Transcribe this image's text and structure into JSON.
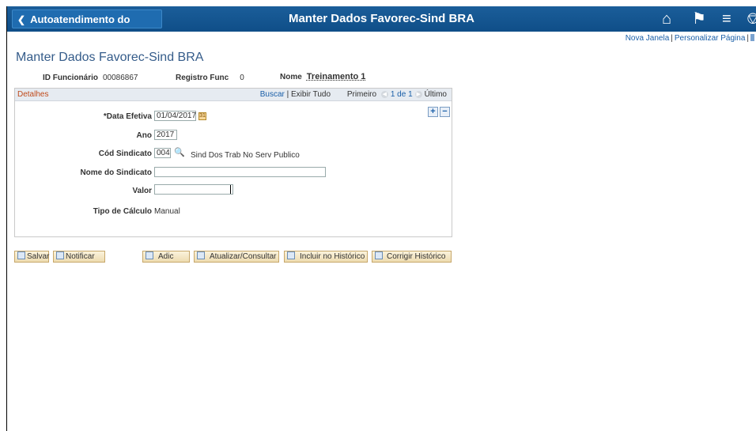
{
  "header": {
    "back_label": "Autoatendimento do Gerente",
    "title": "Manter Dados Favorec-Sind BRA"
  },
  "top_links": {
    "new_window": "Nova Janela",
    "personalize": "Personalizar Página"
  },
  "page_title": "Manter Dados Favorec-Sind BRA",
  "employee": {
    "id_label": "ID Funcionário",
    "id_value": "00086867",
    "reg_label": "Registro Func",
    "reg_value": "0",
    "name_label": "Nome",
    "name_value": "Treinamento 1"
  },
  "details": {
    "title": "Detalhes",
    "search_link": "Buscar",
    "show_all": "Exibir Tudo",
    "first": "Primeiro",
    "page_info": "1 de 1",
    "last": "Último",
    "fields": {
      "effective_date_label": "*Data Efetiva",
      "effective_date_value": "01/04/2017",
      "year_label": "Ano",
      "year_value": "2017",
      "union_code_label": "Cód Sindicato",
      "union_code_value": "004",
      "union_desc": "Sind Dos Trab No Serv Publico",
      "union_name_label": "Nome do Sindicato",
      "union_name_value": "",
      "value_label": "Valor",
      "value_value": "",
      "calc_type_label": "Tipo de Cálculo",
      "calc_type_value": "Manual"
    }
  },
  "toolbar": {
    "save": "Salvar",
    "notify": "Notificar",
    "add": "Adic",
    "update": "Atualizar/Consultar",
    "include_history": "Incluir no Histórico",
    "correct_history": "Corrigir Histórico"
  }
}
